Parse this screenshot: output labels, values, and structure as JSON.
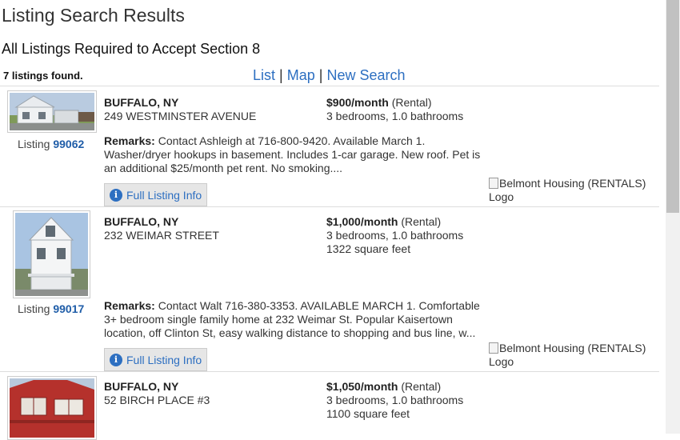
{
  "page": {
    "title": "Listing Search Results",
    "subtitle": "All Listings Required to Accept Section 8",
    "found_count": "7 listings found.",
    "views": {
      "list": "List",
      "sep1": "|",
      "map": "Map",
      "sep2": "|",
      "new_search": "New Search"
    }
  },
  "listings": [
    {
      "listing_label": "Listing",
      "listing_id": "99062",
      "city": "BUFFALO, NY",
      "street": "249 WESTMINSTER AVENUE",
      "price": "$900/month",
      "price_type": "(Rental)",
      "beds_baths": "3 bedrooms, 1.0 bathrooms",
      "sqft": "",
      "remarks_label": "Remarks:",
      "remarks": "Contact Ashleigh at 716-800-9420. Available March 1. Washer/dryer hookups in basement. Includes 1-car garage. New roof. Pet is an additional $25/month pet rent. No smoking....",
      "info_button": "Full Listing Info",
      "logo_alt": "Belmont Housing (RENTALS) Logo"
    },
    {
      "listing_label": "Listing",
      "listing_id": "99017",
      "city": "BUFFALO, NY",
      "street": "232 WEIMAR STREET",
      "price": "$1,000/month",
      "price_type": "(Rental)",
      "beds_baths": "3 bedrooms, 1.0 bathrooms",
      "sqft": "1322 square feet",
      "remarks_label": "Remarks:",
      "remarks": "Contact Walt 716-380-3353. AVAILABLE MARCH 1. Comfortable 3+ bedroom single family home at 232 Weimar St. Popular Kaisertown location, off Clinton St, easy walking distance to shopping and bus line, w...",
      "info_button": "Full Listing Info",
      "logo_alt": "Belmont Housing (RENTALS) Logo"
    },
    {
      "city": "BUFFALO, NY",
      "street": "52 BIRCH PLACE #3",
      "price": "$1,050/month",
      "price_type": "(Rental)",
      "beds_baths": "3 bedrooms, 1.0 bathrooms",
      "sqft": "1100 square feet"
    }
  ]
}
